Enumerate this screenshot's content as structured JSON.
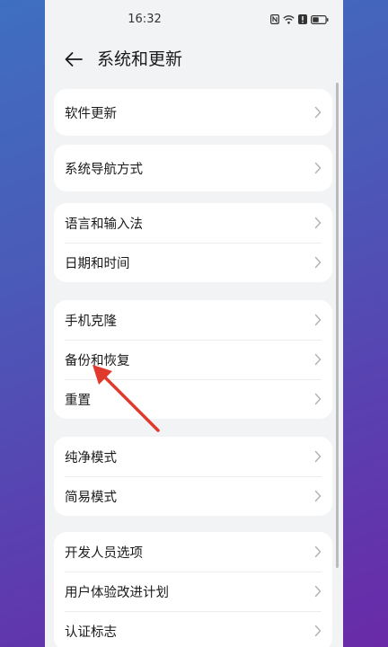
{
  "status_bar": {
    "time": "16:32"
  },
  "header": {
    "title": "系统和更新"
  },
  "groups": [
    {
      "items": [
        {
          "label": "软件更新"
        }
      ]
    },
    {
      "items": [
        {
          "label": "系统导航方式"
        }
      ]
    },
    {
      "items": [
        {
          "label": "语言和输入法"
        },
        {
          "label": "日期和时间"
        }
      ]
    },
    {
      "items": [
        {
          "label": "手机克隆"
        },
        {
          "label": "备份和恢复"
        },
        {
          "label": "重置"
        }
      ]
    },
    {
      "items": [
        {
          "label": "纯净模式"
        },
        {
          "label": "简易模式"
        }
      ]
    },
    {
      "items": [
        {
          "label": "开发人员选项"
        },
        {
          "label": "用户体验改进计划"
        },
        {
          "label": "认证标志"
        }
      ]
    }
  ],
  "colors": {
    "annotation_arrow": "#e03a2f",
    "background_top": "#3f6fc0",
    "background_bottom": "#6a2aa8"
  },
  "icons": {
    "back": "arrow-left-icon",
    "chevron": "chevron-right-icon",
    "nfc": "nfc-icon",
    "wifi": "wifi-icon",
    "alert": "alert-icon",
    "battery": "battery-icon"
  }
}
